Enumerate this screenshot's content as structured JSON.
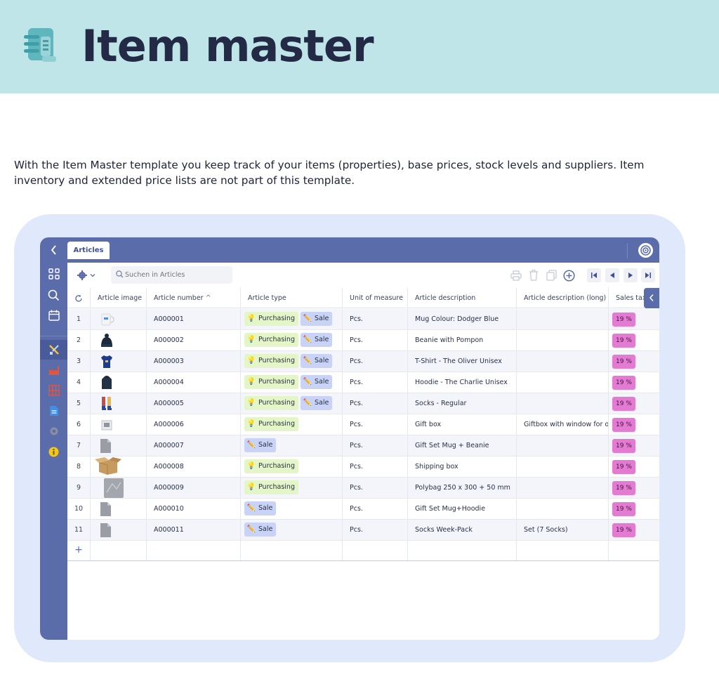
{
  "hero": {
    "title": "Item master"
  },
  "intro": {
    "text": "With the Item Master template you keep track of your items (properties), base prices, stock levels and suppliers. Item inventory and extended price lists are not part of this template."
  },
  "app": {
    "tab_label": "Articles",
    "search_placeholder": "Suchen in Articles",
    "columns": [
      "Article image",
      "Article number",
      "Article type",
      "Unit of measure",
      "Article description",
      "Article description (long)",
      "Sales tax"
    ],
    "sort_indicator": "^",
    "type_labels": {
      "purchasing": "Purchasing",
      "sale": "Sale"
    },
    "rows": [
      {
        "num": "1",
        "image": "mug",
        "number": "A000001",
        "purchasing": true,
        "sale": true,
        "unit": "Pcs.",
        "desc": "Mug Colour: Dodger Blue",
        "desc_long": "",
        "tax": "19 %"
      },
      {
        "num": "2",
        "image": "beanie",
        "number": "A000002",
        "purchasing": true,
        "sale": true,
        "unit": "Pcs.",
        "desc": "Beanie with Pompon",
        "desc_long": "",
        "tax": "19 %"
      },
      {
        "num": "3",
        "image": "tshirt",
        "number": "A000003",
        "purchasing": true,
        "sale": true,
        "unit": "Pcs.",
        "desc": "T-Shirt - The Oliver Unisex",
        "desc_long": "",
        "tax": "19 %"
      },
      {
        "num": "4",
        "image": "hoodie",
        "number": "A000004",
        "purchasing": true,
        "sale": true,
        "unit": "Pcs.",
        "desc": "Hoodie - The Charlie Unisex",
        "desc_long": "",
        "tax": "19 %"
      },
      {
        "num": "5",
        "image": "socks",
        "number": "A000005",
        "purchasing": true,
        "sale": true,
        "unit": "Pcs.",
        "desc": "Socks - Regular",
        "desc_long": "",
        "tax": "19 %"
      },
      {
        "num": "6",
        "image": "giftbox",
        "number": "A000006",
        "purchasing": true,
        "sale": false,
        "unit": "Pcs.",
        "desc": "Gift box",
        "desc_long": "Giftbox with window for on",
        "tax": "19 %"
      },
      {
        "num": "7",
        "image": "file",
        "number": "A000007",
        "purchasing": false,
        "sale": true,
        "unit": "Pcs.",
        "desc": "Gift Set Mug + Beanie",
        "desc_long": "",
        "tax": "19 %"
      },
      {
        "num": "8",
        "image": "carton",
        "number": "A000008",
        "purchasing": true,
        "sale": false,
        "unit": "Pcs.",
        "desc": "Shipping box",
        "desc_long": "",
        "tax": "19 %"
      },
      {
        "num": "9",
        "image": "polybag",
        "number": "A000009",
        "purchasing": true,
        "sale": false,
        "unit": "Pcs.",
        "desc": "Polybag 250 x 300 + 50 mm",
        "desc_long": "",
        "tax": "19 %"
      },
      {
        "num": "10",
        "image": "file",
        "number": "A000010",
        "purchasing": false,
        "sale": true,
        "unit": "Pcs.",
        "desc": "Gift Set Mug+Hoodie",
        "desc_long": "",
        "tax": "19 %"
      },
      {
        "num": "11",
        "image": "file",
        "number": "A000011",
        "purchasing": false,
        "sale": true,
        "unit": "Pcs.",
        "desc": "Socks Week-Pack",
        "desc_long": "Set (7 Socks)",
        "tax": "19 %"
      }
    ],
    "add_row_label": "+"
  },
  "colors": {
    "hero_bg": "#c0e5e9",
    "frame_bg": "#e0e8fb",
    "app_nav": "#5b6caa",
    "purchasing_chip": "#e4f5c8",
    "sale_chip": "#c9d3f5",
    "tax_chip": "#e37bd3"
  }
}
